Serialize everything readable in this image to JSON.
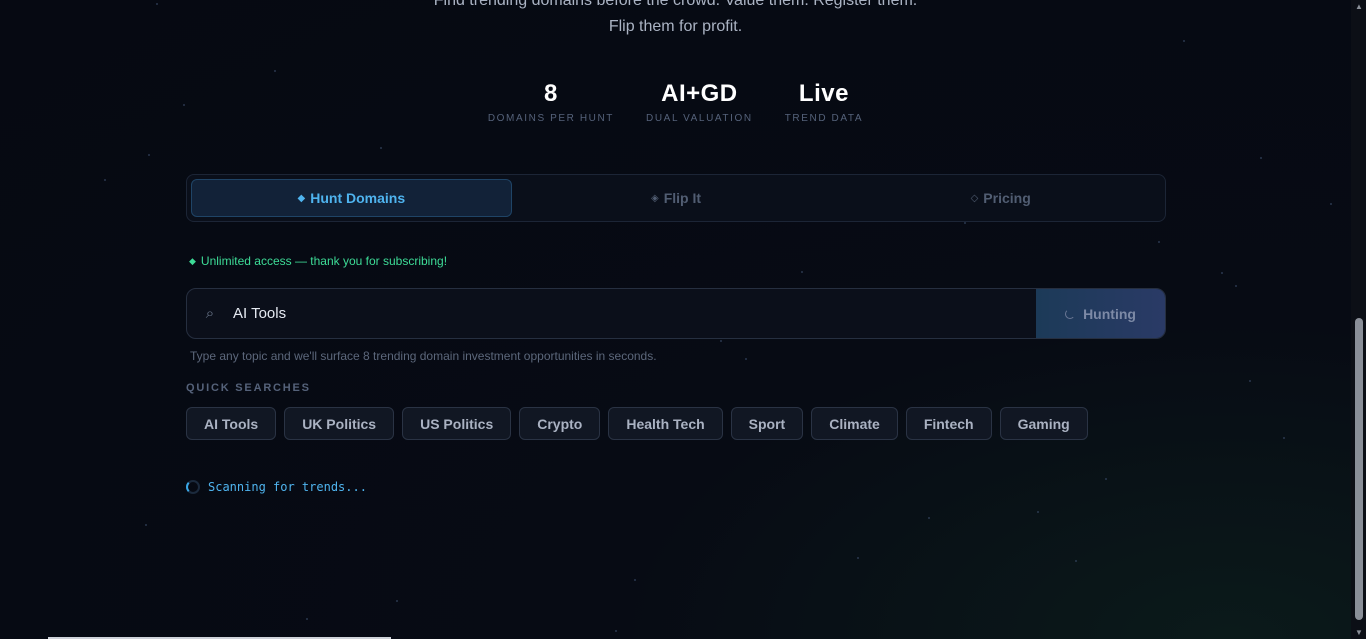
{
  "hero": {
    "tagline_line1": "Find trending domains before the crowd. Value them. Register them.",
    "tagline_line2": "Flip them for profit."
  },
  "stats": [
    {
      "value": "8",
      "label": "DOMAINS PER HUNT"
    },
    {
      "value": "AI+GD",
      "label": "DUAL VALUATION"
    },
    {
      "value": "Live",
      "label": "TREND DATA"
    }
  ],
  "tabs": [
    {
      "icon": "◆",
      "label": "Hunt Domains",
      "active": true
    },
    {
      "icon": "◈",
      "label": "Flip It",
      "active": false
    },
    {
      "icon": "◇",
      "label": "Pricing",
      "active": false
    }
  ],
  "notice": {
    "icon": "◆",
    "text": "Unlimited access — thank you for subscribing!"
  },
  "search": {
    "icon": "⌕",
    "value": "AI Tools",
    "button_label": "Hunting"
  },
  "helper_text": "Type any topic and we'll surface 8 trending domain investment opportunities in seconds.",
  "quick_searches": {
    "title": "QUICK SEARCHES",
    "items": [
      "AI Tools",
      "UK Politics",
      "US Politics",
      "Crypto",
      "Health Tech",
      "Sport",
      "Climate",
      "Fintech",
      "Gaming"
    ]
  },
  "status": {
    "text": "Scanning for trends..."
  }
}
